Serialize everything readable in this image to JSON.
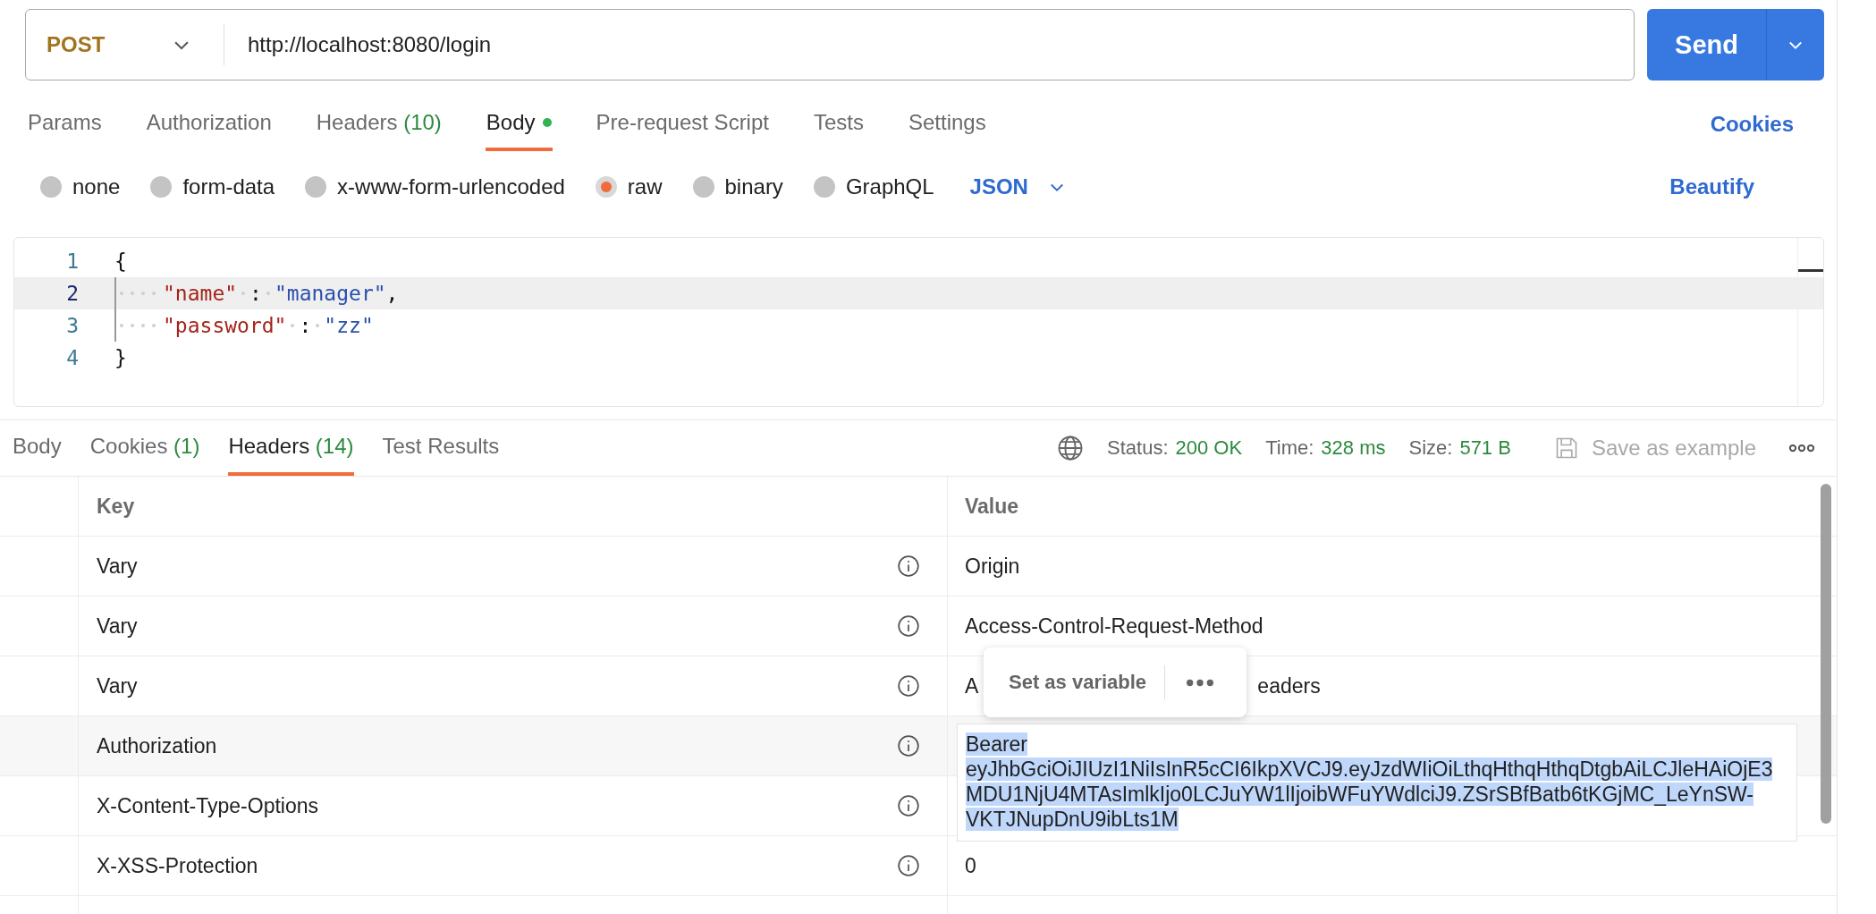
{
  "request": {
    "method": "POST",
    "url": "http://localhost:8080/login",
    "send": "Send"
  },
  "request_tabs": [
    {
      "label": "Params",
      "selected": false
    },
    {
      "label": "Authorization",
      "selected": false
    },
    {
      "label": "Headers",
      "count": "(10)",
      "selected": false
    },
    {
      "label": "Body",
      "dot": true,
      "selected": true
    },
    {
      "label": "Pre-request Script",
      "selected": false
    },
    {
      "label": "Tests",
      "selected": false
    },
    {
      "label": "Settings",
      "selected": false
    }
  ],
  "cookies_link": "Cookies",
  "body_types": [
    {
      "label": "none",
      "selected": false
    },
    {
      "label": "form-data",
      "selected": false
    },
    {
      "label": "x-www-form-urlencoded",
      "selected": false
    },
    {
      "label": "raw",
      "selected": true
    },
    {
      "label": "binary",
      "selected": false
    },
    {
      "label": "GraphQL",
      "selected": false
    }
  ],
  "format": "JSON",
  "beautify": "Beautify",
  "editor": {
    "lines": [
      {
        "number": "1",
        "current": false,
        "indented": false,
        "tokens": [
          {
            "kind": "punct",
            "text": "{"
          }
        ]
      },
      {
        "number": "2",
        "current": true,
        "indented": true,
        "tokens": [
          {
            "kind": "key",
            "text": "\"name\""
          },
          {
            "kind": "punct",
            "text": ":"
          },
          {
            "kind": "string",
            "text": "\"manager\""
          },
          {
            "kind": "comma",
            "text": ","
          }
        ]
      },
      {
        "number": "3",
        "current": false,
        "indented": true,
        "tokens": [
          {
            "kind": "key",
            "text": "\"password\""
          },
          {
            "kind": "punct",
            "text": ":"
          },
          {
            "kind": "string",
            "text": "\"zz\""
          }
        ]
      },
      {
        "number": "4",
        "current": false,
        "indented": false,
        "tokens": [
          {
            "kind": "punct",
            "text": "}"
          }
        ]
      }
    ]
  },
  "response_tabs": [
    {
      "label": "Body",
      "selected": false
    },
    {
      "label": "Cookies",
      "count": "(1)",
      "selected": false
    },
    {
      "label": "Headers",
      "count": "(14)",
      "selected": true
    },
    {
      "label": "Test Results",
      "selected": false
    }
  ],
  "response_meta": [
    {
      "label": "Status:",
      "value": "200 OK"
    },
    {
      "label": "Time:",
      "value": "328 ms"
    },
    {
      "label": "Size:",
      "value": "571 B"
    }
  ],
  "save_example": "Save as example",
  "headers_table": {
    "columns": [
      "Key",
      "Value"
    ],
    "rows": [
      {
        "key": "Vary",
        "value": "Origin",
        "selected": false
      },
      {
        "key": "Vary",
        "value": "Access-Control-Request-Method",
        "selected": false
      },
      {
        "key": "Vary",
        "value": "A",
        "value_tail": "eaders",
        "selected": false
      },
      {
        "key": "Authorization",
        "value": "Bearer eyJhbGciOiJIUzI1NiIsInR5cCI6IkpXVCJ9.eyJzdWIiOiLthqHthqHthqDtgbAiLCJleHAiOjE3MDU1NjU4MTAsImlkIjo0LCJuYW1lIjoibWFuYWdlciJ9.ZSrSBfBatb6tKGjMC_LeYnSW-VKTJNupDnU9ibLts1M",
        "selected": true
      },
      {
        "key": "X-Content-Type-Options",
        "selected": false
      },
      {
        "key": "X-XSS-Protection",
        "value": "0",
        "selected": false
      }
    ]
  },
  "popup": {
    "label": "Set as variable"
  }
}
